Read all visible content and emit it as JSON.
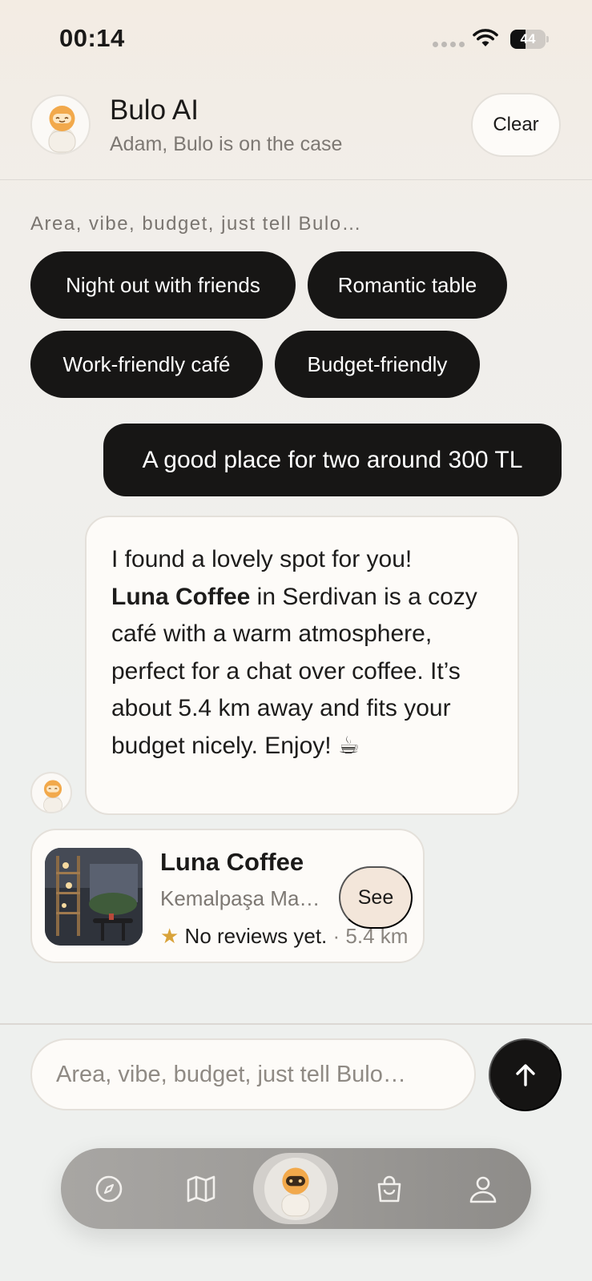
{
  "status_bar": {
    "time": "00:14",
    "battery": "44",
    "battery_level": 0.44
  },
  "header": {
    "title": "Bulo AI",
    "subtitle": "Adam, Bulo is on the case",
    "clear_label": "Clear"
  },
  "hint": "Area, vibe, budget, just tell Bulo…",
  "chips": [
    {
      "label": "Night out with friends"
    },
    {
      "label": "Romantic table"
    },
    {
      "label": "Work-friendly café"
    },
    {
      "label": "Budget-friendly"
    }
  ],
  "messages": {
    "user": "A good place for two around 300 TL",
    "bot": {
      "line1": "I found a lovely spot for you!",
      "bold": "Luna Coffee",
      "rest": " in Serdivan is a cozy café with a warm atmosphere, perfect for a chat over coffee. It’s about 5.4 km away and fits your budget nicely. Enjoy! ☕"
    }
  },
  "place_card": {
    "name": "Luna Coffee",
    "address": "Kemalpaşa Mahallesi",
    "star": "★",
    "reviews": "No reviews yet.",
    "distance": " · 5.4 km",
    "see_label": "See"
  },
  "composer": {
    "placeholder": "Area, vibe, budget, just tell Bulo…"
  },
  "tabbar": {
    "items": [
      {
        "icon": "compass-icon"
      },
      {
        "icon": "map-icon"
      },
      {
        "icon": "bulo-mascot-icon"
      },
      {
        "icon": "shopping-bag-icon"
      },
      {
        "icon": "profile-icon"
      }
    ]
  },
  "colors": {
    "accent_dark": "#171615",
    "see_button": "#f3e6da",
    "star": "#d9a33a"
  }
}
